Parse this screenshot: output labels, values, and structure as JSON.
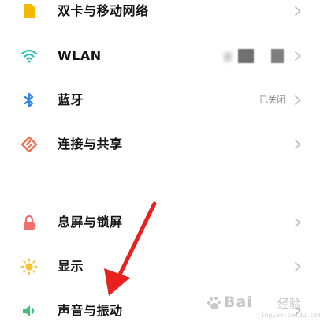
{
  "settings": {
    "items": [
      {
        "label": "双卡与移动网络",
        "icon": "sim-card-icon",
        "status": "",
        "color": "#F5B800"
      },
      {
        "label": "WLAN",
        "icon": "wifi-icon",
        "status": "",
        "color": "#2FC1BE"
      },
      {
        "label": "蓝牙",
        "icon": "bluetooth-icon",
        "status": "已关闭",
        "color": "#2E86E8"
      },
      {
        "label": "连接与共享",
        "icon": "share-connection-icon",
        "status": "",
        "color": "#F07050"
      },
      {
        "label": "息屏与锁屏",
        "icon": "lock-icon",
        "status": "",
        "color": "#F2706A"
      },
      {
        "label": "显示",
        "icon": "sun-icon",
        "status": "",
        "color": "#F7C234"
      },
      {
        "label": "声音与振动",
        "icon": "speaker-icon",
        "status": "",
        "color": "#3FC07A"
      }
    ]
  },
  "watermark": {
    "brand": "Bai",
    "sub": "经验",
    "url": "jingyan.baidu.com"
  },
  "annotation": {
    "arrow_color": "#E8201E"
  }
}
